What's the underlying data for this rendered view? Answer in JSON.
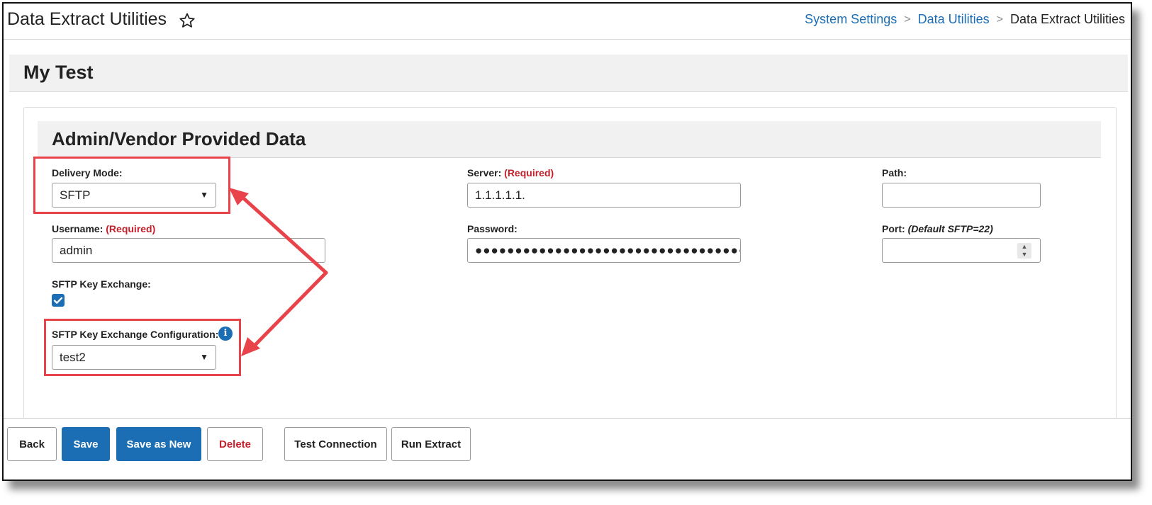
{
  "header": {
    "title": "Data Extract Utilities",
    "breadcrumb": [
      "System Settings",
      "Data Utilities",
      "Data Extract Utilities"
    ],
    "separator": ">"
  },
  "record_title": "My Test",
  "section_title": "Admin/Vendor Provided Data",
  "form": {
    "delivery_mode": {
      "label": "Delivery Mode:",
      "value": "SFTP"
    },
    "server": {
      "label": "Server:",
      "required": "(Required)",
      "value": "1.1.1.1.1."
    },
    "path": {
      "label": "Path:",
      "value": ""
    },
    "username": {
      "label": "Username:",
      "required": "(Required)",
      "value": "admin"
    },
    "password": {
      "label": "Password:",
      "masked": "●●●●●●●●●●●●●●●●●●●●●●●●●●●●●●●●●●●●"
    },
    "port": {
      "label": "Port:",
      "hint": "(Default SFTP=22)",
      "value": ""
    },
    "key_exchange": {
      "label": "SFTP Key Exchange:",
      "checked": true,
      "check_glyph": "✓"
    },
    "key_exchange_config": {
      "label": "SFTP Key Exchange Configuration:",
      "value": "test2",
      "info_glyph": "i"
    }
  },
  "footer": {
    "back": "Back",
    "save": "Save",
    "save_as_new": "Save as New",
    "delete": "Delete",
    "test_connection": "Test Connection",
    "run_extract": "Run Extract"
  },
  "colors": {
    "accent": "#1b6db4",
    "required": "#c41f2a",
    "annotation": "#e8434a"
  },
  "icons": {
    "favorite": "star-icon",
    "dropdown": "caret-down-icon",
    "info": "info-icon",
    "checkbox": "check-icon"
  }
}
